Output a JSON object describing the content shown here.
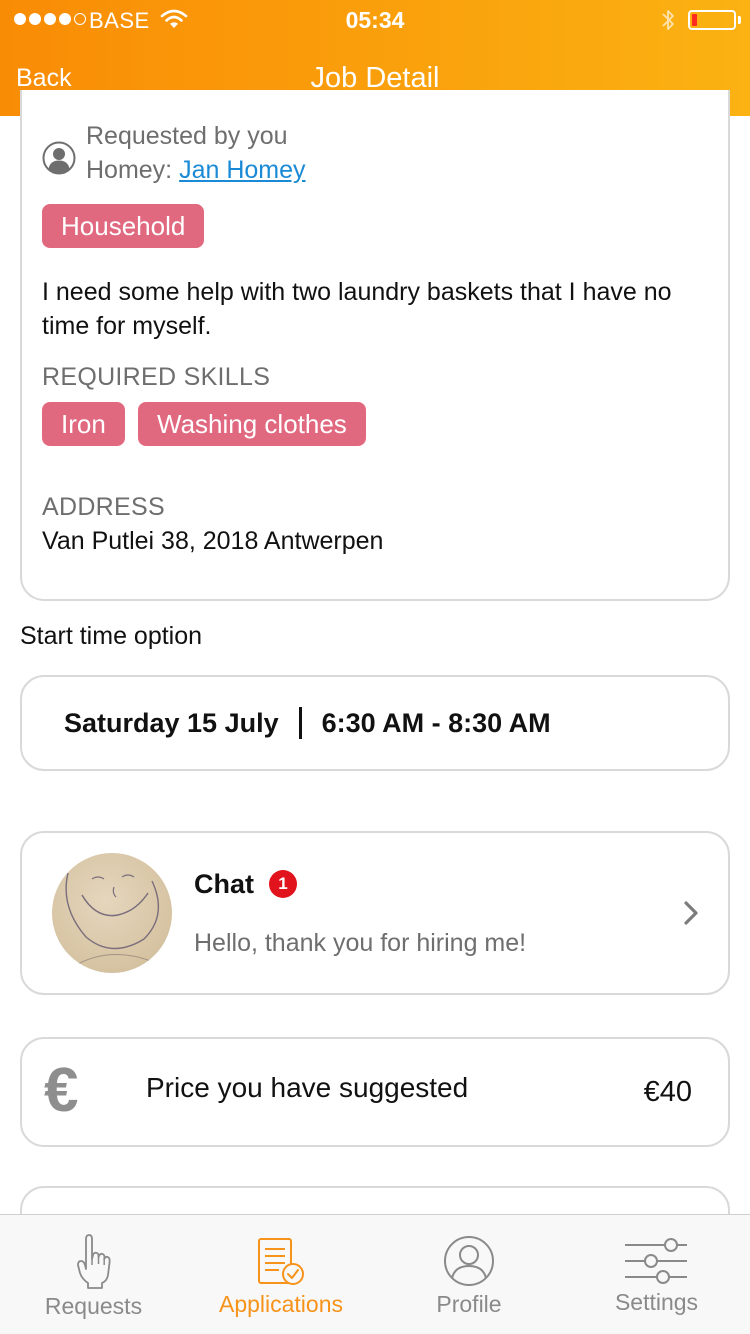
{
  "status_bar": {
    "carrier": "BASE",
    "time": "05:34",
    "battery_level": 0.12,
    "battery_color": "#ff2a1f"
  },
  "nav": {
    "back_label": "Back",
    "title": "Job Detail"
  },
  "job": {
    "requested_by": "Requested by you",
    "homey_prefix": "Homey:",
    "homey_name": "Jan Homey",
    "category": "Household",
    "description": "I need some help with two laundry baskets that I have no time for myself.",
    "skills_label": "REQUIRED SKILLS",
    "skills": [
      "Iron",
      "Washing clothes"
    ],
    "address_label": "ADDRESS",
    "address": "Van Putlei 38, 2018 Antwerpen"
  },
  "start_time": {
    "section_title": "Start time option",
    "date": "Saturday 15 July",
    "range": "6:30 AM - 8:30 AM"
  },
  "chat": {
    "title": "Chat",
    "unread_count": "1",
    "last_message": "Hello, thank you for hiring me!"
  },
  "price": {
    "icon": "€",
    "label": "Price you have suggested",
    "value": "€40"
  },
  "tabs": [
    {
      "label": "Requests",
      "icon": "hand-pointer-icon",
      "active": false
    },
    {
      "label": "Applications",
      "icon": "document-check-icon",
      "active": true
    },
    {
      "label": "Profile",
      "icon": "user-circle-icon",
      "active": false
    },
    {
      "label": "Settings",
      "icon": "sliders-icon",
      "active": false
    }
  ],
  "colors": {
    "header_start": "#f98c05",
    "header_end": "#fbb212",
    "tag": "#e0687f",
    "link": "#1a8ad6",
    "badge": "#e1141e",
    "tab_active": "#f7931a",
    "tab_inactive": "#8a8a8a"
  }
}
